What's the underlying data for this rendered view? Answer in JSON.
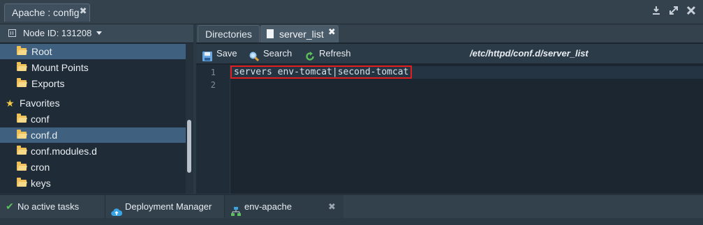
{
  "window": {
    "tab_title": "Apache : config",
    "close_glyph": "✖",
    "tools": [
      "download-icon",
      "expand-icon",
      "close-icon"
    ]
  },
  "left_panel": {
    "node_label": "Node ID: 131208",
    "tree": [
      {
        "label": "Root",
        "icon": "folder-open-icon",
        "selected": true
      },
      {
        "label": "Mount Points",
        "icon": "folder-icon",
        "selected": false
      },
      {
        "label": "Exports",
        "icon": "folder-share-icon",
        "selected": false
      },
      {
        "label": "Favorites",
        "icon": "star-icon",
        "selected": false
      },
      {
        "label": "conf",
        "icon": "folder-icon",
        "selected": false
      },
      {
        "label": "conf.d",
        "icon": "folder-open-icon",
        "selected": true
      },
      {
        "label": "conf.modules.d",
        "icon": "folder-icon",
        "selected": false
      },
      {
        "label": "cron",
        "icon": "folder-icon",
        "selected": false
      },
      {
        "label": "keys",
        "icon": "folder-icon",
        "selected": false
      }
    ]
  },
  "right_panel": {
    "tabs": [
      {
        "label": "Directories"
      },
      {
        "label": "server_list",
        "active": true
      }
    ],
    "toolbar": {
      "save_label": "Save",
      "search_label": "Search",
      "refresh_label": "Refresh",
      "file_path": "/etc/httpd/conf.d/server_list"
    },
    "editor": {
      "lines": [
        {
          "number": "1",
          "text": "servers env-tomcat|second-tomcat"
        },
        {
          "number": "2",
          "text": ""
        }
      ]
    }
  },
  "taskbar": {
    "status_label": "No active tasks",
    "deployment_label": "Deployment Manager",
    "env_label": "env-apache"
  },
  "colors": {
    "accent_selected": "#3f607e",
    "highlight_border": "#e02020",
    "folder": "#f0c158",
    "check_green": "#5cc15c",
    "cloud_blue": "#3aa3e3"
  }
}
